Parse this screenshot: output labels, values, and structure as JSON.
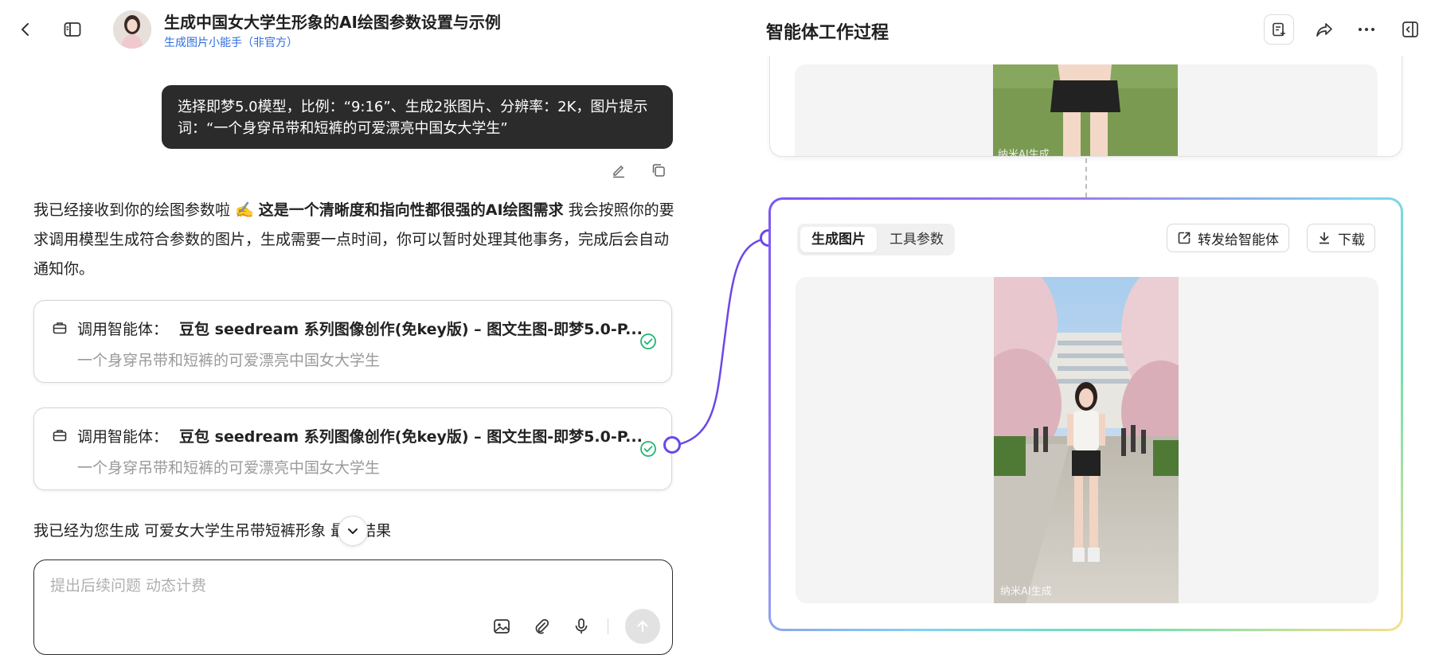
{
  "header": {
    "conversation_title": "生成中国女大学生形象的AI绘图参数设置与示例",
    "agent_name": "生成图片小能手（非官方）"
  },
  "chat": {
    "user_message": "选择即梦5.0模型，比例：“9:16”、生成2张图片、分辨率：2K，图片提示词：“一个身穿吊带和短裤的可爱漂亮中国女大学生”",
    "assistant_intro": "我已经接收到你的绘图参数啦 ✍️ ",
    "assistant_bold": "这是一个清晰度和指向性都很强的AI绘图需求",
    "assistant_rest": " 我会按照你的要求调用模型生成符合参数的图片，生成需要一点时间，你可以暂时处理其他事务，完成后会自动通知你。",
    "tool_calls": [
      {
        "prefix": "调用智能体：",
        "name": "豆包 seedream 系列图像创作(免key版) – 图文生图-即梦5.0-P...",
        "prompt": "一个身穿吊带和短裤的可爱漂亮中国女大学生"
      },
      {
        "prefix": "调用智能体：",
        "name": "豆包 seedream 系列图像创作(免key版) – 图文生图-即梦5.0-P...",
        "prompt": "一个身穿吊带和短裤的可爱漂亮中国女大学生"
      }
    ],
    "final_message": "我已经为您生成 可爱女大学生吊带短裤形象 最终结果",
    "composer_placeholder": "提出后续问题 动态计费"
  },
  "panel": {
    "title": "智能体工作过程",
    "tabs": [
      "生成图片",
      "工具参数"
    ],
    "forward_label": "转发给智能体",
    "download_label": "下载",
    "watermark_upper": "纳米AI生成",
    "watermark_lower": "纳米AI生成"
  },
  "icons": {
    "back": "chevron-left-icon",
    "sidebar": "sidebar-toggle-icon",
    "edit": "pencil-icon",
    "copy": "copy-icon",
    "tool": "briefcase-icon",
    "success": "check-circle-icon",
    "scroll_down": "chevron-down-icon",
    "image_upload": "image-icon",
    "attach": "paperclip-icon",
    "mic": "microphone-icon",
    "send": "arrow-up-icon",
    "notes": "note-add-icon",
    "share": "share-icon",
    "more": "more-horizontal-icon",
    "collapse_panel": "collapse-panel-icon",
    "forward": "external-link-icon",
    "download": "download-icon"
  },
  "colors": {
    "accent_blue": "#2f6de0",
    "bubble_bg": "#2b2b2b",
    "success_green": "#22b573",
    "connector_purple": "#6c47e8"
  }
}
